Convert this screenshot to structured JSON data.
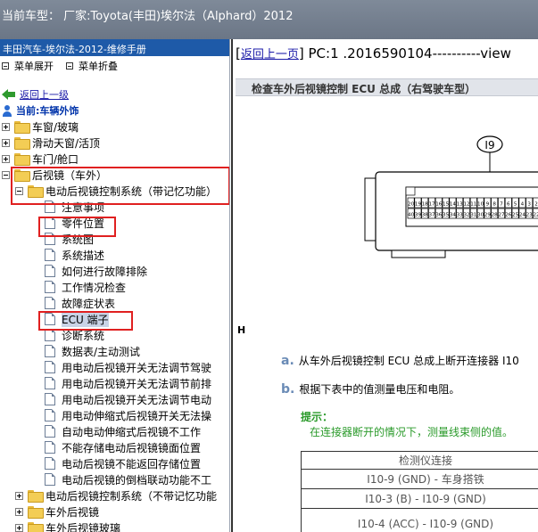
{
  "window": {
    "title": "当前车型： 厂家:Toyota(丰田)埃尔法（Alphard）2012"
  },
  "left_panel": {
    "header": "丰田汽车-埃尔法-2012-维修手册",
    "toolbar": {
      "expand_label": "菜单展开",
      "collapse_label": "菜单折叠"
    },
    "back_link": "返回上一级",
    "current_label": "当前:车辆外饰",
    "tree": [
      {
        "label": "车窗/玻璃",
        "type": "folder",
        "state": "collapsed",
        "level": 0
      },
      {
        "label": "滑动天窗/活顶",
        "type": "folder",
        "state": "collapsed",
        "level": 0
      },
      {
        "label": "车门/舱口",
        "type": "folder",
        "state": "collapsed",
        "level": 0
      },
      {
        "label": "后视镜（车外）",
        "type": "folder",
        "state": "expanded",
        "level": 0
      },
      {
        "label": "电动后视镜控制系统（带记忆功能）",
        "type": "folder",
        "state": "expanded",
        "level": 1
      },
      {
        "label": "注意事项",
        "type": "doc",
        "level": 2
      },
      {
        "label": "零件位置",
        "type": "doc",
        "level": 2
      },
      {
        "label": "系统图",
        "type": "doc",
        "level": 2
      },
      {
        "label": "系统描述",
        "type": "doc",
        "level": 2
      },
      {
        "label": "如何进行故障排除",
        "type": "doc",
        "level": 2
      },
      {
        "label": "工作情况检查",
        "type": "doc",
        "level": 2
      },
      {
        "label": "故障症状表",
        "type": "doc",
        "level": 2
      },
      {
        "label": "ECU 端子",
        "type": "doc",
        "level": 2,
        "selected": true
      },
      {
        "label": "诊断系统",
        "type": "doc",
        "level": 2
      },
      {
        "label": "数据表/主动测试",
        "type": "doc",
        "level": 2
      },
      {
        "label": "用电动后视镜开关无法调节驾驶",
        "type": "doc",
        "level": 2
      },
      {
        "label": "用电动后视镜开关无法调节前排",
        "type": "doc",
        "level": 2
      },
      {
        "label": "用电动后视镜开关无法调节电动",
        "type": "doc",
        "level": 2
      },
      {
        "label": "用电动伸缩式后视镜开关无法操",
        "type": "doc",
        "level": 2
      },
      {
        "label": "自动电动伸缩式后视镜不工作",
        "type": "doc",
        "level": 2
      },
      {
        "label": "不能存储电动后视镜镜面位置",
        "type": "doc",
        "level": 2
      },
      {
        "label": "电动后视镜不能返回存储位置",
        "type": "doc",
        "level": 2
      },
      {
        "label": "电动后视镜的倒档联动功能不工",
        "type": "doc",
        "level": 2
      },
      {
        "label": "电动后视镜控制系统（不带记忆功能",
        "type": "folder",
        "state": "collapsed",
        "level": 1
      },
      {
        "label": "车外后视镜",
        "type": "folder",
        "state": "collapsed",
        "level": 1
      },
      {
        "label": "车外后视镜玻璃",
        "type": "folder",
        "state": "collapsed",
        "level": 1
      }
    ]
  },
  "content": {
    "back_link": "返回上一页",
    "pc_text": "] PC:1 .2016590104----------view",
    "section_title": "检查车外后视镜控制 ECU 总成（右驾驶车型）",
    "connector": {
      "id": "I9",
      "top_row": [
        "20",
        "19",
        "18",
        "17",
        "16",
        "15",
        "14",
        "13",
        "12",
        "11",
        "10",
        "9",
        "8",
        "7",
        "6",
        "5",
        "4",
        "3",
        "2",
        "1"
      ],
      "bottom_row": [
        "40",
        "39",
        "38",
        "37",
        "36",
        "35",
        "34",
        "33",
        "32",
        "31",
        "30",
        "29",
        "28",
        "27",
        "26",
        "25",
        "24",
        "23",
        "22",
        "21"
      ]
    },
    "h_label": "H",
    "steps": [
      {
        "letter": "a.",
        "text": "从车外后视镜控制 ECU 总成上断开连接器 I10"
      },
      {
        "letter": "b.",
        "text": "根据下表中的值测量电压和电阻。"
      }
    ],
    "hint": {
      "title": "提示：",
      "text": "在连接器断开的情况下，测量线束侧的值。"
    },
    "table": {
      "header": "检测仪连接",
      "rows": [
        "I10-9 (GND) - 车身搭铁",
        "I10-3 (B) - I10-9 (GND)",
        "I10-4 (ACC) - I10-9 (GND)"
      ]
    }
  }
}
